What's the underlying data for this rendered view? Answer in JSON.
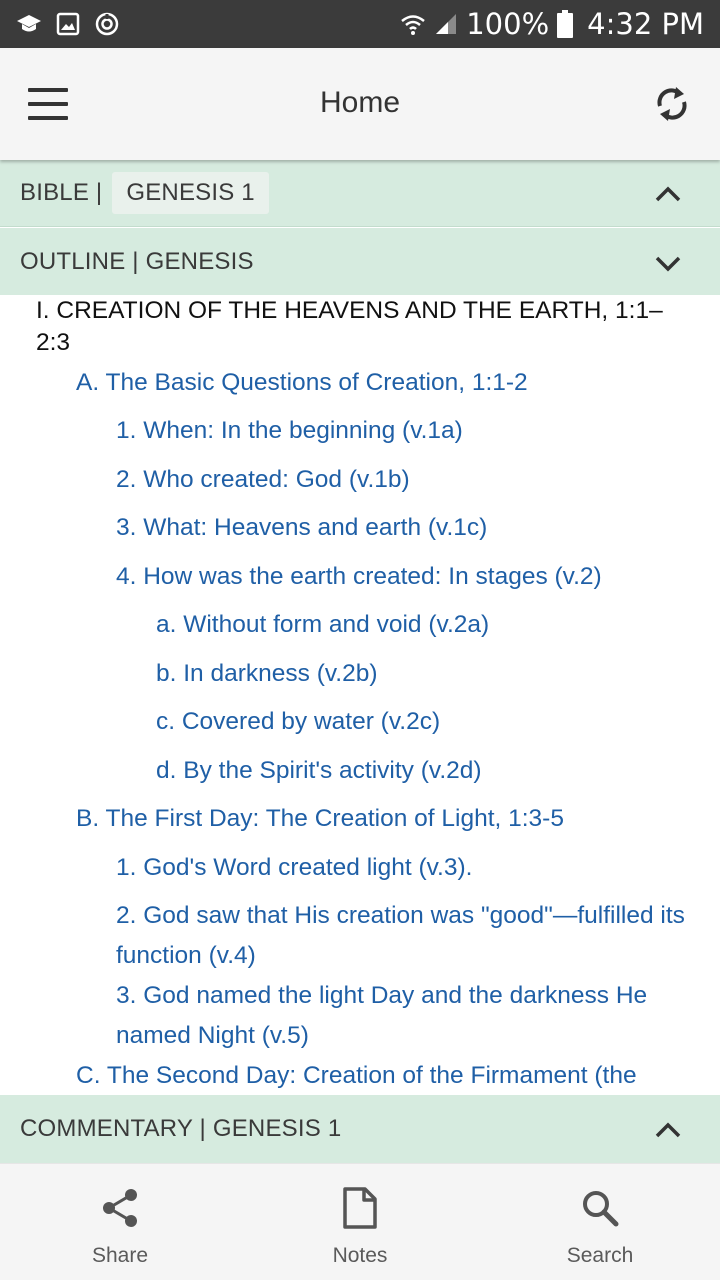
{
  "status_bar": {
    "battery": "100%",
    "time": "4:32 PM"
  },
  "app_bar": {
    "title": "Home"
  },
  "bible_section": {
    "label": "BIBLE |",
    "book_chip": "GENESIS 1"
  },
  "outline_section": {
    "label": "OUTLINE | GENESIS"
  },
  "outline": {
    "heading": "I. CREATION OF THE HEAVENS AND THE EARTH, 1:1–2:3",
    "items": [
      "A. The Basic Questions of Creation, 1:1-2",
      "1. When: In the beginning (v.1a)",
      "2. Who created: God (v.1b)",
      "3. What: Heavens and earth (v.1c)",
      "4. How was the earth created: In stages (v.2)",
      "a. Without form and void (v.2a)",
      "b. In darkness (v.2b)",
      "c. Covered by water (v.2c)",
      "d. By the Spirit's activity (v.2d)",
      "B. The First Day: The Creation of Light, 1:3-5",
      "1. God's Word created light (v.3).",
      "2. God saw that His creation was \"good\"—fulfilled its function (v.4)",
      "3. God named the light Day and the darkness He named Night (v.5)",
      "C. The Second Day: Creation of the Firmament (the"
    ]
  },
  "commentary_section": {
    "label": "COMMENTARY | GENESIS 1"
  },
  "bottom_nav": {
    "share": "Share",
    "notes": "Notes",
    "search": "Search"
  },
  "colors": {
    "status_bar": "#3b3b3b",
    "app_bar": "#f5f5f5",
    "section_header": "#d6ebdf",
    "link": "#1f5fa6"
  }
}
